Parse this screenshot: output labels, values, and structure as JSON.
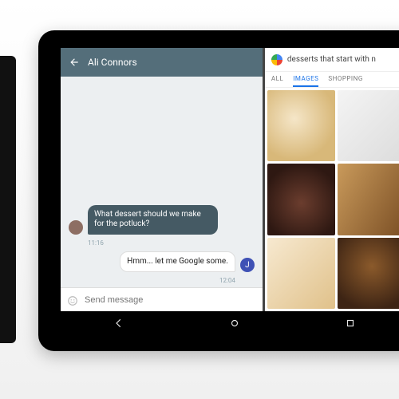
{
  "chat": {
    "header": {
      "title": "Ali Connors"
    },
    "messages": [
      {
        "side": "in",
        "text": "What dessert should we make for the potluck?",
        "time": "11:16"
      },
      {
        "side": "out",
        "text": "Hmm... let me Google some.",
        "time": "12:04",
        "avatar_initial": "J"
      }
    ],
    "compose": {
      "placeholder": "Send message"
    }
  },
  "search": {
    "query": "desserts that start with n",
    "tabs": [
      {
        "label": "ALL",
        "active": false
      },
      {
        "label": "IMAGES",
        "active": true
      },
      {
        "label": "SHOPPING",
        "active": false
      }
    ]
  },
  "navbar": {
    "back": "back-icon",
    "home": "home-icon",
    "recent": "recent-icon"
  },
  "colors": {
    "chat_header": "#546e7a",
    "incoming_bubble": "#455a64",
    "tab_active": "#1a73e8",
    "avatar_j": "#3f51b5"
  }
}
